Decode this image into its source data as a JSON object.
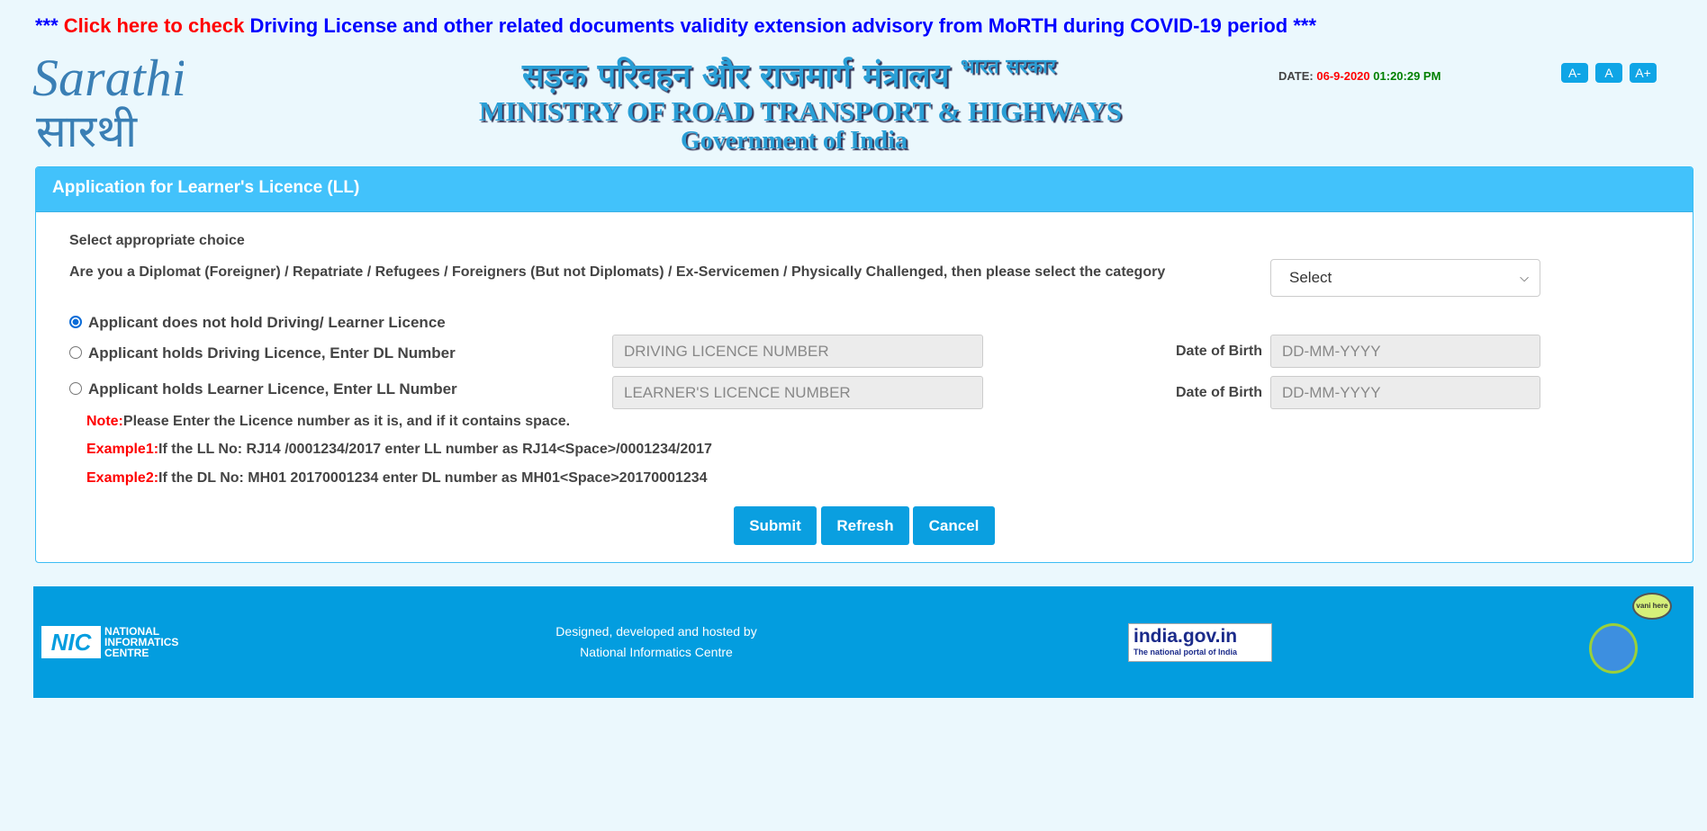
{
  "banner": {
    "prefix": "*** ",
    "click_text": "Click here to check",
    "text": " Driving License and other related documents validity extension advisory from MoRTH during COVID-19 period ***"
  },
  "header": {
    "logo_text": "Sarathi",
    "hindi": "सड़क परिवहन और राजमार्ग मंत्रालय",
    "hindi_small": "भारत सरकार",
    "ministry": "MINISTRY OF ROAD TRANSPORT & HIGHWAYS",
    "government": "Government of India",
    "date_label": "DATE: ",
    "date": "06-9-2020",
    "time": "01:20:29 PM",
    "font_buttons": [
      "A-",
      "A",
      "A+"
    ]
  },
  "panel": {
    "title": "Application for Learner's Licence (LL)",
    "select_prompt": "Select appropriate choice",
    "category_question": "Are you a Diplomat (Foreigner) / Repatriate / Refugees / Foreigners (But not Diplomats) / Ex-Servicemen / Physically Challenged, then please select the category",
    "category_select": "Select",
    "options": [
      {
        "label": "Applicant does not hold Driving/ Learner Licence",
        "selected": true
      },
      {
        "label": "Applicant holds Driving Licence, Enter DL Number",
        "selected": false,
        "placeholder": "DRIVING LICENCE NUMBER"
      },
      {
        "label": "Applicant holds Learner Licence, Enter LL Number",
        "selected": false,
        "placeholder": "LEARNER'S LICENCE NUMBER"
      }
    ],
    "dob_label": "Date of Birth",
    "dob_placeholder": "DD-MM-YYYY",
    "note_label": "Note:",
    "note": "Please Enter the Licence number as it is, and if it contains space.",
    "ex1_label": "Example1:",
    "ex1": "If the LL No: RJ14 /0001234/2017 enter LL number as RJ14<Space>/0001234/2017",
    "ex2_label": "Example2:",
    "ex2": "If the DL No: MH01 20170001234 enter DL number as MH01<Space>20170001234",
    "buttons": {
      "submit": "Submit",
      "refresh": "Refresh",
      "cancel": "Cancel"
    }
  },
  "footer": {
    "nic": [
      "NATIONAL",
      "INFORMATICS",
      "CENTRE"
    ],
    "credit_line1": "Designed, developed and hosted by",
    "credit_line2": "National Informatics Centre",
    "india_portal": "india.gov.in",
    "india_tagline": "The national portal of India",
    "vani": "vani here"
  },
  "colors": {
    "accent": "#42c2fb",
    "footer": "#039ddf",
    "button": "#0a9fe0"
  }
}
